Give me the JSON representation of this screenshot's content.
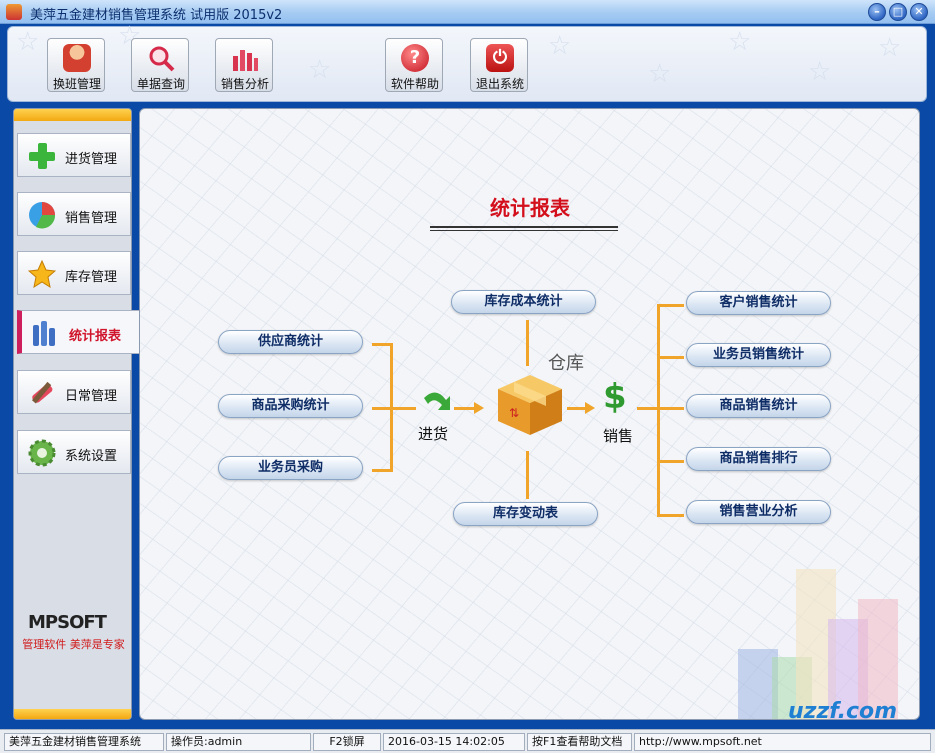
{
  "window": {
    "title": "美萍五金建材销售管理系统 试用版 2015v2"
  },
  "toolbar": {
    "buttons": [
      {
        "label": "换班管理",
        "icon": "users-icon"
      },
      {
        "label": "单据查询",
        "icon": "magnifier-icon"
      },
      {
        "label": "销售分析",
        "icon": "bar-chart-icon"
      },
      {
        "label": "软件帮助",
        "icon": "help-icon"
      },
      {
        "label": "退出系统",
        "icon": "power-icon"
      }
    ]
  },
  "sidebar": {
    "items": [
      {
        "label": "进货管理",
        "icon": "plus-icon"
      },
      {
        "label": "销售管理",
        "icon": "pie-icon"
      },
      {
        "label": "库存管理",
        "icon": "star-icon"
      },
      {
        "label": "统计报表",
        "icon": "bars-icon",
        "active": true
      },
      {
        "label": "日常管理",
        "icon": "tools-icon"
      },
      {
        "label": "系统设置",
        "icon": "gear-icon"
      }
    ],
    "brand": "MPSOFT",
    "brand_tagline": "管理软件  美萍是专家"
  },
  "main": {
    "title": "统计报表",
    "left_buttons": [
      "供应商统计",
      "商品采购统计",
      "业务员采购"
    ],
    "top_button": "库存成本统计",
    "bottom_button": "库存变动表",
    "right_buttons": [
      "客户销售统计",
      "业务员销售统计",
      "商品销售统计",
      "商品销售排行",
      "销售营业分析"
    ],
    "label_purchase": "进货",
    "label_warehouse": "仓库",
    "label_sales": "销售"
  },
  "statusbar": {
    "app": "美萍五金建材销售管理系统",
    "operator": "操作员:admin",
    "lock": "F2锁屏",
    "datetime": "2016-03-15 14:02:05",
    "help": "按F1查看帮助文档",
    "url": "http://www.mpsoft.net"
  },
  "watermark": "uzzf.com"
}
